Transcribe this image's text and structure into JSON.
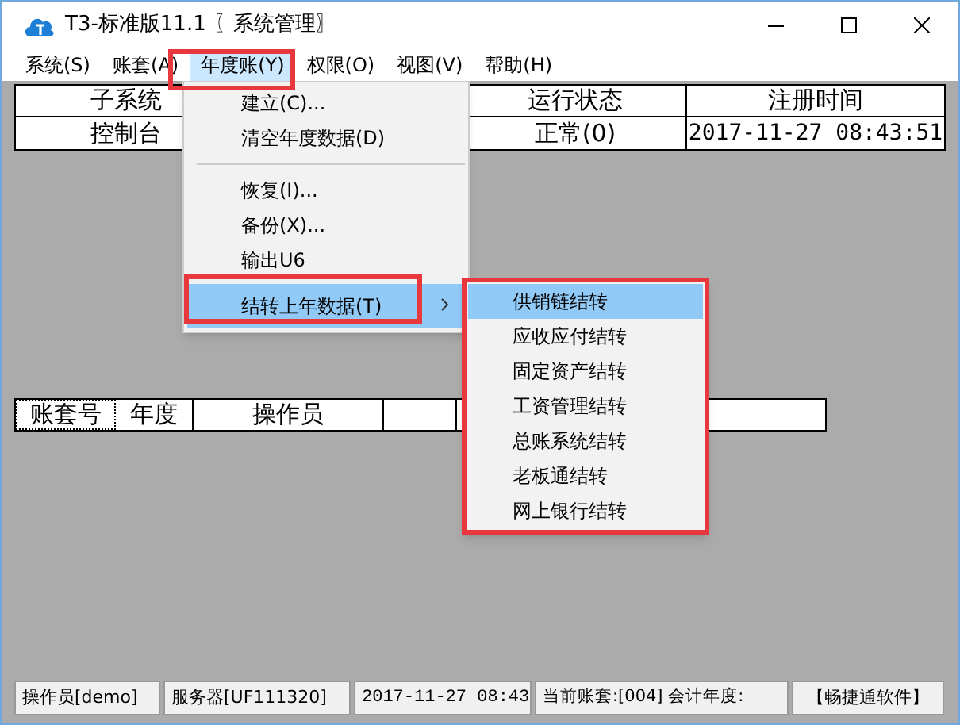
{
  "window": {
    "title": "T3-标准版11.1 〖系统管理〗"
  },
  "menu_bar": [
    {
      "label": "系统(S)",
      "selected": false
    },
    {
      "label": "账套(A)",
      "selected": false
    },
    {
      "label": "年度账(Y)",
      "selected": true
    },
    {
      "label": "权限(O)",
      "selected": false
    },
    {
      "label": "视图(V)",
      "selected": false
    },
    {
      "label": "帮助(H)",
      "selected": false
    }
  ],
  "top_table": {
    "columns": [
      "子系统",
      "运行状态",
      "注册时间"
    ],
    "rows": [
      [
        "控制台",
        "正常(0)",
        "2017-11-27 08:43:51"
      ]
    ]
  },
  "menu": [
    {
      "kind": "item",
      "label": "建立(C)...",
      "selected": false
    },
    {
      "kind": "item",
      "label": "清空年度数据(D)",
      "selected": false
    },
    {
      "kind": "separator"
    },
    {
      "kind": "item",
      "label": "恢复(I)...",
      "selected": false
    },
    {
      "kind": "item",
      "label": "备份(X)...",
      "selected": false
    },
    {
      "kind": "item",
      "label": "输出U6",
      "selected": false
    },
    {
      "kind": "submenu",
      "label": "结转上年数据(T)",
      "selected": true
    }
  ],
  "submenu": [
    {
      "label": "供销链结转",
      "selected": true
    },
    {
      "label": "应收应付结转",
      "selected": false
    },
    {
      "label": "固定资产结转",
      "selected": false
    },
    {
      "label": "工资管理结转",
      "selected": false
    },
    {
      "label": "总账系统结转",
      "selected": false
    },
    {
      "label": "老板通结转",
      "selected": false
    },
    {
      "label": "网上银行结转",
      "selected": false
    }
  ],
  "bottom_table": {
    "columns": [
      "账套号",
      "年度",
      "操作员"
    ]
  },
  "status_bar": [
    "操作员[demo]",
    "服务器[UF111320]",
    "2017-11-27 08:43",
    "当前账套:[004] 会计年度:",
    "【畅捷通软件】"
  ]
}
